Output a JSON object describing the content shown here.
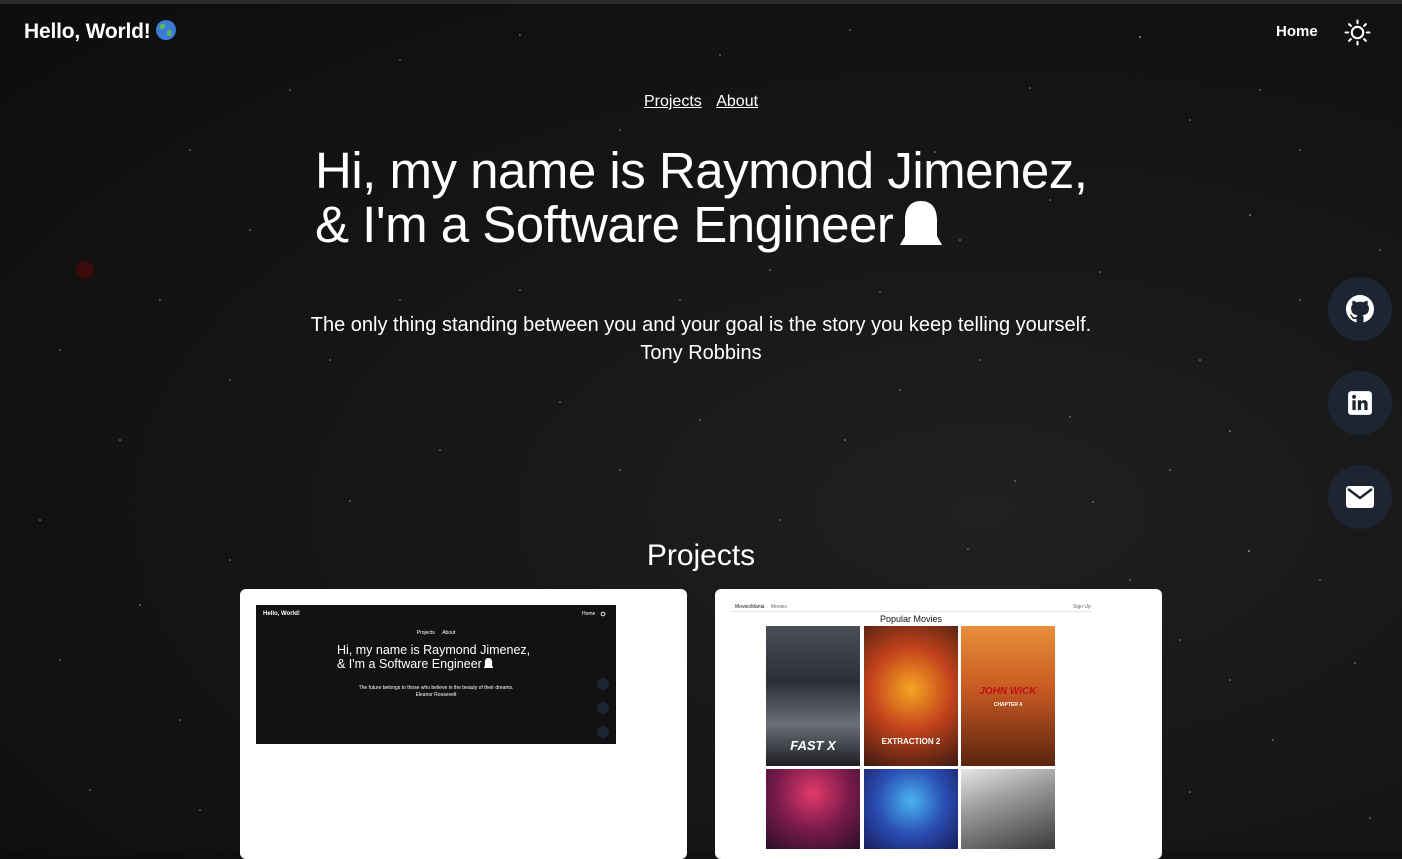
{
  "header": {
    "brand": "Hello, World!",
    "nav_home": "Home"
  },
  "subnav": {
    "projects": "Projects",
    "about": "About"
  },
  "hero": {
    "line1": "Hi, my name is Raymond Jimenez,",
    "line2": "& I'm a Software Engineer"
  },
  "quote": {
    "text": "The only thing standing between you and your goal is the story you keep telling yourself.",
    "author": "Tony Robbins"
  },
  "social": [
    "github-icon",
    "linkedin-icon",
    "mail-icon"
  ],
  "projects": {
    "title": "Projects",
    "portfolio_preview": {
      "brand": "Hello, World!",
      "home": "Home",
      "projects": "Projects",
      "about": "About",
      "line1": "Hi, my name is Raymond Jimenez,",
      "line2": "& I'm a Software Engineer",
      "quote": "The future belongs to those who believe in the beauty of their dreams.",
      "author": "Eleanor Roosevelt"
    },
    "movies_preview": {
      "brand": "MoviesMania",
      "movies": "Movies",
      "signup": "Sign Up",
      "title": "Popular Movies",
      "poster_titles": [
        "FAST X",
        "EXTRACTION 2",
        "JOHN WICK",
        "CHAPTER 4"
      ]
    }
  },
  "colors": {
    "background": "#141414",
    "social_bg": "#1d2432",
    "card_bg": "#ffffff"
  }
}
